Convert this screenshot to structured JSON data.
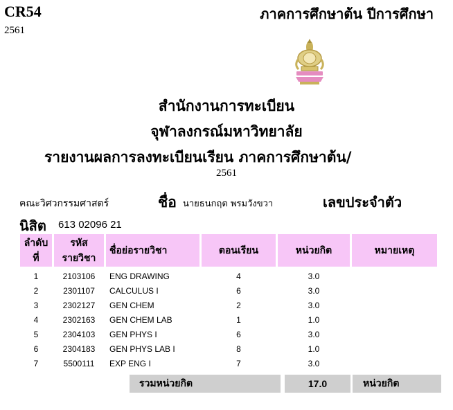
{
  "header": {
    "form_code": "CR54",
    "term_title": "ภาคการศึกษาต้น  ปีการศึกษา",
    "year": "2561"
  },
  "titles": {
    "office": "สำนักงานการทะเบียน",
    "university": "จุฬาลงกรณ์มหาวิทยาลัย",
    "report": "รายงานผลการลงทะเบียนเรียน   ภาคการศึกษาต้น/",
    "report_year": "2561"
  },
  "student": {
    "faculty": "คณะวิศวกรรมศาสตร์",
    "name_label": "ชื่อ",
    "name": "นายธนกฤต พรมวังขวา",
    "id_label_part1": "เลขประจำตัว",
    "id_label_part2": "นิสิต",
    "id": "613 02096 21"
  },
  "table": {
    "headers": {
      "no_line1": "ลำดับ",
      "no_line2": "ที่",
      "code_line1": "รหัส",
      "code_line2": "รายวิชา",
      "name": "ชื่อย่อรายวิชา",
      "section": "ตอนเรียน",
      "credits": "หน่วยกิต",
      "note": "หมายเหตุ"
    },
    "rows": [
      {
        "no": "1",
        "code": "2103106",
        "name": "ENG DRAWING",
        "section": "4",
        "credits": "3.0",
        "note": ""
      },
      {
        "no": "2",
        "code": "2301107",
        "name": "CALCULUS I",
        "section": "6",
        "credits": "3.0",
        "note": ""
      },
      {
        "no": "3",
        "code": "2302127",
        "name": "GEN CHEM",
        "section": "2",
        "credits": "3.0",
        "note": ""
      },
      {
        "no": "4",
        "code": "2302163",
        "name": "GEN CHEM LAB",
        "section": "1",
        "credits": "1.0",
        "note": ""
      },
      {
        "no": "5",
        "code": "2304103",
        "name": "GEN PHYS I",
        "section": "6",
        "credits": "3.0",
        "note": ""
      },
      {
        "no": "6",
        "code": "2304183",
        "name": "GEN PHYS LAB I",
        "section": "8",
        "credits": "1.0",
        "note": ""
      },
      {
        "no": "7",
        "code": "5500111",
        "name": "EXP ENG I",
        "section": "7",
        "credits": "3.0",
        "note": ""
      }
    ]
  },
  "summary": {
    "total_label": "รวมหน่วยกิต",
    "total_value": "17.0",
    "unit_label": "หน่วยกิต"
  },
  "colors": {
    "header_bg": "#f7c6f7",
    "summary_bg": "#cfcfcf",
    "seal_gold": "#c9b25a",
    "seal_pink": "#e58cc0"
  },
  "icons": {
    "seal": "chula-phra-kiao-emblem"
  }
}
